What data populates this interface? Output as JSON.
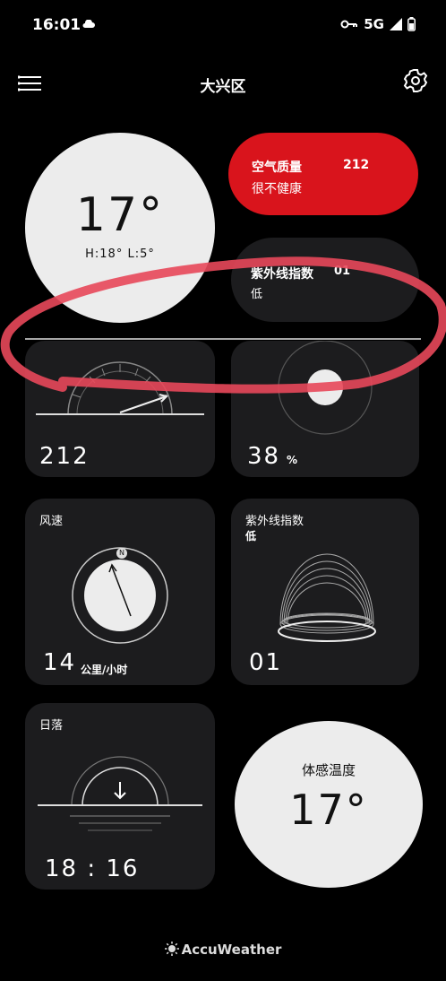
{
  "status_bar": {
    "time": "16:01",
    "network": "5G"
  },
  "header": {
    "title": "大兴区"
  },
  "temperature": {
    "value": "17°",
    "high_low": "H:18° L:5°"
  },
  "air_quality": {
    "label": "空气质量",
    "value": "212",
    "status": "很不健康"
  },
  "uv_pill": {
    "label": "紫外线指数",
    "value": "01",
    "level": "低"
  },
  "aqi_card": {
    "value": "212"
  },
  "humidity_card": {
    "value": "38",
    "unit": "%"
  },
  "wind_card": {
    "title": "风速",
    "value": "14",
    "unit": "公里/小时",
    "compass_n": "N"
  },
  "uv_card": {
    "title": "紫外线指数",
    "level": "低",
    "value": "01"
  },
  "sunset_card": {
    "title": "日落",
    "time": "18 : 16"
  },
  "feels_like": {
    "label": "体感温度",
    "value": "17°"
  },
  "footer": {
    "brand": "AccuWeather"
  },
  "colors": {
    "accent_red": "#d9141c",
    "annotation_red": "#e8485a",
    "card_bg": "#1c1c1e",
    "light_circle": "#ececec"
  },
  "icons": [
    "menu-icon",
    "gear-icon",
    "cloud-icon",
    "vpn-key-icon",
    "signal-icon",
    "battery-icon",
    "compass-icon",
    "sunset-arrow-icon",
    "accuweather-sun-icon"
  ]
}
